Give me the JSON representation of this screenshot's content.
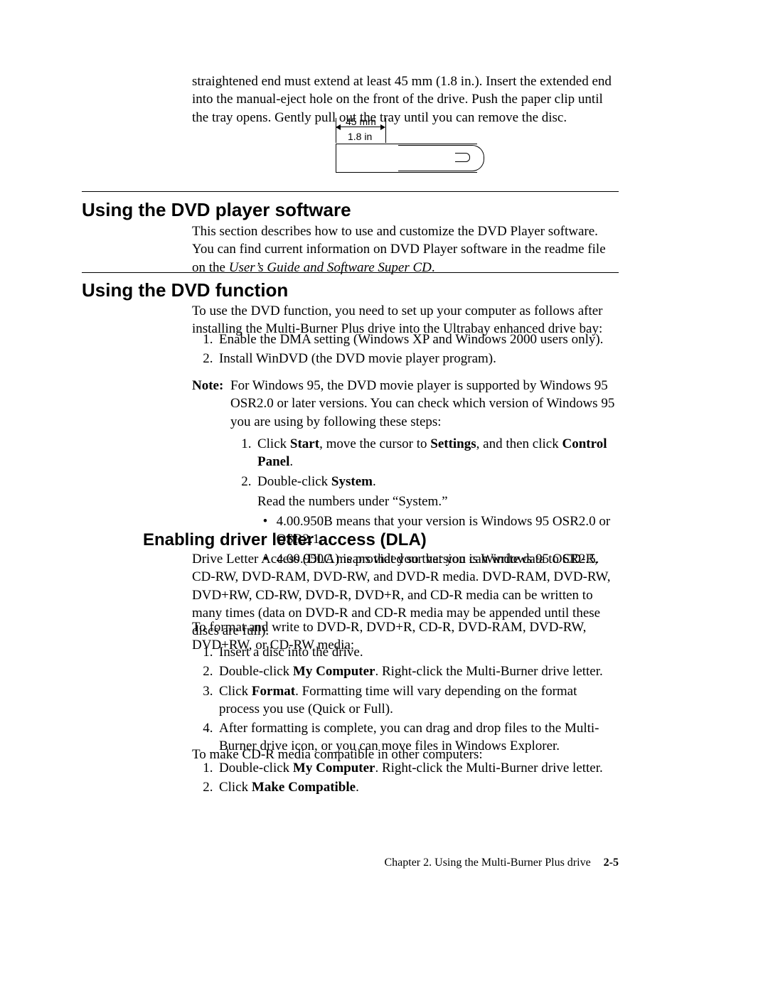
{
  "intro_paragraph": "straightened end must extend at least 45 mm (1.8 in.). Insert the extended end into the manual-eject hole on the front of the drive. Push the paper clip until the tray opens. Gently pull out the tray until you can remove the disc.",
  "figure": {
    "dim_mm": "45 mm",
    "dim_in": "1.8 in"
  },
  "section1": {
    "title": "Using the DVD player software",
    "para_pre": "This section describes how to use and customize the DVD Player software. You can find current information on DVD Player software in the readme file on the ",
    "para_italic": "User’s Guide and Software Super CD",
    "para_post": "."
  },
  "section2": {
    "title": "Using the DVD function",
    "para": "To use the DVD function, you need to set up your computer as follows after installing the Multi-Burner Plus drive into the Ultrabay enhanced drive bay:",
    "steps": [
      "Enable the DMA setting (Windows XP and Windows 2000 users only).",
      "Install WinDVD (the DVD movie player program)."
    ],
    "note": {
      "label": "Note:",
      "body": "For Windows 95, the DVD movie player is supported by Windows 95 OSR2.0 or later versions. You can check which version of Windows 95 you are using by following these steps:",
      "steps": {
        "s1": {
          "pre": "Click ",
          "b1": "Start",
          "mid1": ", move the cursor to ",
          "b2": "Settings",
          "mid2": ", and then click ",
          "b3": "Control Panel",
          "post": "."
        },
        "s2": {
          "pre": "Double-click ",
          "b1": "System",
          "post": ".",
          "read": "Read the numbers under “System.”",
          "bullets": [
            "4.00.950B means that your version is Windows 95 OSR2.0 or OSR2.1.",
            "4.00.950C means that your version is Windows 95 OSR2.5."
          ]
        }
      }
    }
  },
  "section3": {
    "title": "Enabling driver letter access (DLA)",
    "para1": "Drive Letter Access (DLA) is provided so that you can write data to CD-R, CD-RW, DVD-RAM, DVD-RW, and DVD-R media. DVD-RAM, DVD-RW, DVD+RW, CD-RW, DVD-R, DVD+R, and CD-R media can be written to many times (data on DVD-R and CD-R media may be appended until these discs are full).",
    "para2": "To format and write to DVD-R, DVD+R, CD-R, DVD-RAM, DVD-RW, DVD+RW, or CD-RW media:",
    "stepsA": {
      "s1": "Insert a disc into the drive.",
      "s2": {
        "pre": "Double-click ",
        "b1": "My Computer",
        "post": ". Right-click the Multi-Burner drive letter."
      },
      "s3": {
        "pre": "Click ",
        "b1": "Format",
        "post": ". Formatting time will vary depending on the format process you use (Quick or Full)."
      },
      "s4": "After formatting is complete, you can drag and drop files to the Multi-Burner drive icon, or you can move files in Windows Explorer."
    },
    "para3": "To make CD-R media compatible in other computers:",
    "stepsB": {
      "s1": {
        "pre": "Double-click ",
        "b1": "My Computer",
        "post": ". Right-click the Multi-Burner drive letter."
      },
      "s2": {
        "pre": "Click ",
        "b1": "Make Compatible",
        "post": "."
      }
    }
  },
  "footer": {
    "chapter": "Chapter 2. Using the Multi-Burner Plus drive",
    "page": "2-5"
  }
}
